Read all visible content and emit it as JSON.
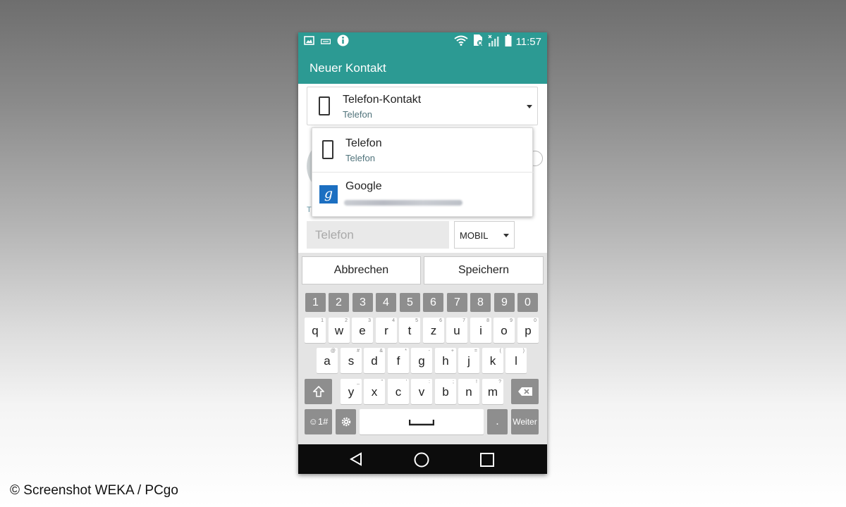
{
  "status_bar": {
    "time": "11:57",
    "left_icons": [
      "image-icon",
      "keyboard-icon",
      "info-icon"
    ],
    "right_icons": [
      "wifi-icon",
      "sim-card-icon",
      "signal-icon",
      "battery-icon"
    ]
  },
  "app_bar": {
    "title": "Neuer Kontakt"
  },
  "account_selector": {
    "title": "Telefon-Kontakt",
    "subtitle": "Telefon"
  },
  "account_popup": {
    "items": [
      {
        "title": "Telefon",
        "subtitle": "Telefon",
        "icon": "phone-icon"
      },
      {
        "title": "Google",
        "subtitle": "",
        "icon": "google-icon"
      }
    ]
  },
  "phone_field": {
    "placeholder": "Telefon",
    "type_value": "MOBIL"
  },
  "ghost_label": "T",
  "actions": {
    "cancel": "Abbrechen",
    "save": "Speichern"
  },
  "keyboard": {
    "numbers": [
      "1",
      "2",
      "3",
      "4",
      "5",
      "6",
      "7",
      "8",
      "9",
      "0"
    ],
    "row1": [
      "q",
      "w",
      "e",
      "r",
      "t",
      "z",
      "u",
      "i",
      "o",
      "p"
    ],
    "row1_hints": [
      "1",
      "2",
      "3",
      "4",
      "5",
      "6",
      "7",
      "8",
      "9",
      "0"
    ],
    "row2": [
      "a",
      "s",
      "d",
      "f",
      "g",
      "h",
      "j",
      "k",
      "l"
    ],
    "row2_hints": [
      "@",
      "#",
      "&",
      "*",
      "-",
      "+",
      "=",
      "(",
      ")"
    ],
    "row3": [
      "y",
      "x",
      "c",
      "v",
      "b",
      "n",
      "m"
    ],
    "row3_hints": [
      "_",
      "\"",
      "'",
      ":",
      ";",
      "!",
      "?"
    ],
    "symbols_key": "☺1#",
    "enter_key": "Weiter",
    "period_key": "."
  },
  "watermark": "© Screenshot WEKA / PCgo",
  "colors": {
    "teal_header": "#2c9a93",
    "nav_bar": "#0c0c0c",
    "google_blue": "#1c6fc1"
  }
}
